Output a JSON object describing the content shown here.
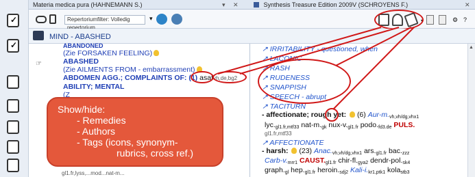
{
  "left_tab": {
    "title": "Materia medica pura (HAHNEMANN S.)",
    "pin": "▾",
    "close": "✕"
  },
  "right_tab": {
    "title": "Synthesis Treasure Edition 2009V (SCHROYENS F.)",
    "close": "✕"
  },
  "toolbar": {
    "filter_label": "Repertoriumfilter:",
    "filter_value": "Volledig repertorium"
  },
  "header": {
    "title": "MIND - ABASHED"
  },
  "left_lines": [
    "ABANDONED",
    "(Zie FORSAKEN FEELING)",
    "ABASHED",
    "(Zie AILMENTS FROM - embarrassment)",
    "ABDOMEN AGG.; COMPLAINTS OF: (1)",
    "asaf",
    "vh,de,bg2",
    "ABILITY; MENTAL",
    "(Z"
  ],
  "callout": {
    "heading": "Show/hide:",
    "items": [
      "- Remedies",
      "- Authors",
      "- Tags (icons, synonym-",
      "rubrics, cross ref.)"
    ]
  },
  "left_bottom_snippet": "gl1.fr,lyss,...mod...nat-m...",
  "right_lines": {
    "r1": "IRRITABILITY - questioned, when",
    "r2": "LACONIC",
    "r3": "RASH",
    "r4": "RUDENESS",
    "r5": "SNAPPISH",
    "r6": "SPEECH - abrupt",
    "r7": "TACITURN",
    "r8a": "- affectionate; rough yet:",
    "r8b": "(6)",
    "r8c": "Aur-m.",
    "r8d": "vh,vh/dg,vhx1",
    "r9a": "lyc.",
    "r9b": "gl1.fr,mtf33",
    "r9c": "nat-m.",
    "r9d": "gk",
    "r9e": "nux-v.",
    "r9f": "gl1.fr",
    "r9g": "podo.",
    "r9h": "fd3.de",
    "r9i": "PULS.",
    "r10": "gl1.fr,mtf33",
    "r11": "AFFECTIONATE",
    "r12a": "- harsh:",
    "r12b": "(23)",
    "r12c": "Anac.",
    "r12d": "vh,vh/dg,vhx1",
    "r12e": "ars.",
    "r12f": "gl1.fr",
    "r12g": "bac.",
    "r12h": "zzz",
    "r13a": "Carb-v.",
    "r13b": "mrr1",
    "r13c": "CAUST.",
    "r13d": "gl1.fr",
    "r13e": "chir-fl.",
    "r13f": "gya2",
    "r13g": "dendr-pol.",
    "r13h": "sk4",
    "r14a": "graph.",
    "r14b": "gl",
    "r14c": "hep.",
    "r14d": "gl1.fr",
    "r14e": "heroin.",
    "r14f": "sdj2",
    "r14g": "Kali-i.",
    "r14h": "kr1,ptk1",
    "r14i": "kola",
    "r14j": "stb3"
  }
}
